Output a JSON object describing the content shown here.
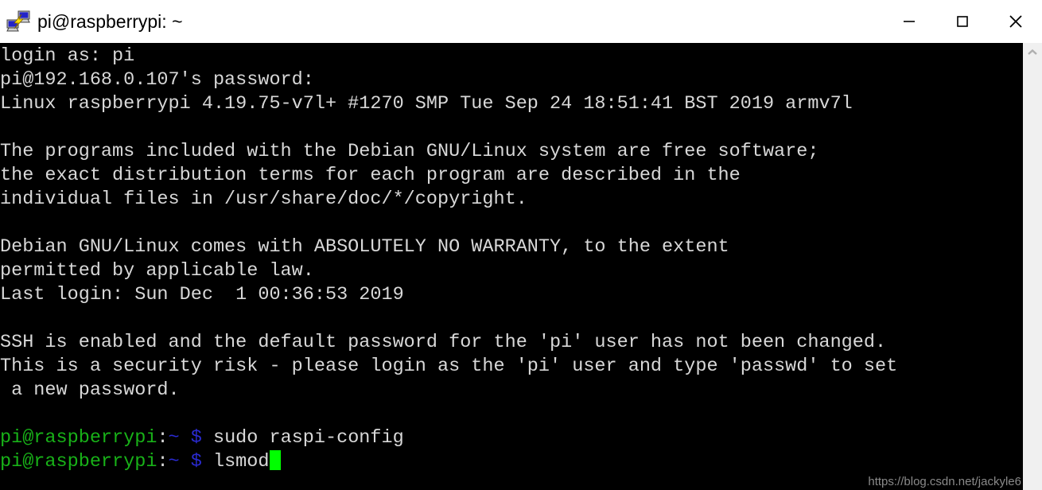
{
  "window": {
    "title": "pi@raspberrypi: ~",
    "icon": "putty-computers-lightning-icon",
    "minimize_label": "—",
    "maximize_label": "☐",
    "close_label": "✕",
    "background_color": "#000000",
    "text_color": "#d8d8d8"
  },
  "terminal": {
    "lines": [
      {
        "segments": [
          {
            "text": "login as: pi",
            "color": "gray"
          }
        ]
      },
      {
        "segments": [
          {
            "text": "pi@192.168.0.107's password:",
            "color": "gray"
          }
        ]
      },
      {
        "segments": [
          {
            "text": "Linux raspberrypi 4.19.75-v7l+ #1270 SMP Tue Sep 24 18:51:41 BST 2019 armv7l",
            "color": "gray"
          }
        ]
      },
      {
        "segments": [
          {
            "text": "",
            "color": "gray"
          }
        ]
      },
      {
        "segments": [
          {
            "text": "The programs included with the Debian GNU/Linux system are free software;",
            "color": "gray"
          }
        ]
      },
      {
        "segments": [
          {
            "text": "the exact distribution terms for each program are described in the",
            "color": "gray"
          }
        ]
      },
      {
        "segments": [
          {
            "text": "individual files in /usr/share/doc/*/copyright.",
            "color": "gray"
          }
        ]
      },
      {
        "segments": [
          {
            "text": "",
            "color": "gray"
          }
        ]
      },
      {
        "segments": [
          {
            "text": "Debian GNU/Linux comes with ABSOLUTELY NO WARRANTY, to the extent",
            "color": "gray"
          }
        ]
      },
      {
        "segments": [
          {
            "text": "permitted by applicable law.",
            "color": "gray"
          }
        ]
      },
      {
        "segments": [
          {
            "text": "Last login: Sun Dec  1 00:36:53 2019",
            "color": "gray"
          }
        ]
      },
      {
        "segments": [
          {
            "text": "",
            "color": "gray"
          }
        ]
      },
      {
        "segments": [
          {
            "text": "SSH is enabled and the default password for the 'pi' user has not been changed.",
            "color": "gray"
          }
        ]
      },
      {
        "segments": [
          {
            "text": "This is a security risk - please login as the 'pi' user and type 'passwd' to set",
            "color": "gray"
          }
        ]
      },
      {
        "segments": [
          {
            "text": " a new password.",
            "color": "gray"
          }
        ]
      },
      {
        "segments": [
          {
            "text": "",
            "color": "gray"
          }
        ]
      },
      {
        "segments": [
          {
            "text": "pi@raspberrypi",
            "color": "green"
          },
          {
            "text": ":",
            "color": "gray"
          },
          {
            "text": "~",
            "color": "blue"
          },
          {
            "text": " ",
            "color": "gray"
          },
          {
            "text": "$",
            "color": "blue"
          },
          {
            "text": " sudo raspi-config",
            "color": "gray"
          }
        ]
      },
      {
        "segments": [
          {
            "text": "pi@raspberrypi",
            "color": "green"
          },
          {
            "text": ":",
            "color": "gray"
          },
          {
            "text": "~",
            "color": "blue"
          },
          {
            "text": " ",
            "color": "gray"
          },
          {
            "text": "$",
            "color": "blue"
          },
          {
            "text": " lsmod",
            "color": "gray"
          }
        ],
        "cursor": true
      }
    ],
    "colors": {
      "prompt_user_host": "#18b218",
      "prompt_path": "#2a2ad1",
      "prompt_symbol": "#2a2ad1",
      "foreground": "#d8d8d8",
      "cursor": "#00ff00"
    }
  },
  "scrollbar": {
    "up_arrow": "chevron-up-icon",
    "down_arrow": "chevron-down-icon"
  },
  "watermark": {
    "text": "https://blog.csdn.net/jackyle6"
  }
}
